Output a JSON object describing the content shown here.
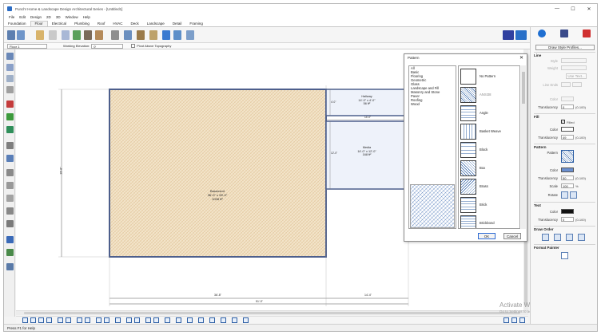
{
  "window": {
    "title": "Punch! Home & Landscape Design Architectural Series - [Untitled1]",
    "controls": [
      "—",
      "☐",
      "✕"
    ]
  },
  "menu": [
    "File",
    "Edit",
    "Design",
    "2D",
    "3D",
    "Window",
    "Help"
  ],
  "tabs": [
    "Foundation",
    "Floor",
    "Electrical",
    "Plumbing",
    "Roof",
    "HVAC",
    "Deck",
    "Landscape",
    "Detail",
    "Framing"
  ],
  "active_tab": "Floor",
  "options_bar": {
    "floor": "Floor 1",
    "working_elevation_label": "Working Elevation:",
    "working_elevation_value": "0'",
    "pivot_label": "Pivot Above Topography"
  },
  "plan": {
    "rooms": [
      {
        "name": "Basement",
        "dims": "36'-0\" x 28'-0\"",
        "area": "1008 ft²"
      },
      {
        "name": "Hallway",
        "dims": "14'-0\" x 4'-0\"",
        "area": "56 ft²"
      },
      {
        "name": "Media",
        "dims": "14'-0\" x 12'-0\"",
        "area": "168 ft²"
      }
    ],
    "dims": {
      "left": "28'-8\"",
      "bottom_main": "36'-8\"",
      "bottom_right": "14'-4\"",
      "bottom_total": "51'-0\"",
      "media_top": "14'-0\"",
      "media_side": "12'-0\"",
      "hall_side": "4'-0\""
    }
  },
  "dialog": {
    "title": "Pattern",
    "close": "✕",
    "categories": [
      "All",
      "Basic",
      "Flooring",
      "Geometric",
      "Glass",
      "Landscape and Fill",
      "Masonry and Stone",
      "Paver",
      "Roofing",
      "Wood"
    ],
    "patterns": [
      "No Pattern",
      "ANSI38",
      "Angle",
      "Basket Weave",
      "Block",
      "Box",
      "Brass",
      "Brick",
      "Brickbond"
    ],
    "selected_pattern": "ANSI38",
    "ok": "OK",
    "cancel": "Cancel"
  },
  "panel": {
    "draw_style_button": "Draw Style Profiles...",
    "line": {
      "header": "Line",
      "style_label": "Style",
      "weight_label": "Weight",
      "use_text_button": "Use Text...",
      "line_ends_label": "Line Ends",
      "color_label": "Color",
      "translucency_label": "Translucency",
      "translucency_value": "0",
      "translucency_unit": "(0-100)"
    },
    "fill": {
      "header": "Fill",
      "filled_label": "Filled",
      "color_label": "Color",
      "translucency_label": "Translucency",
      "translucency_value": "49",
      "translucency_unit": "(0-100)"
    },
    "pattern": {
      "header": "Pattern",
      "pattern_label": "Pattern",
      "color_label": "Color",
      "translucency_label": "Translucency",
      "translucency_value": "50",
      "translucency_unit": "(0-100)",
      "scale_label": "Scale",
      "scale_value": "100",
      "scale_unit": "%",
      "rotate_label": "Rotate"
    },
    "text": {
      "header": "Text",
      "color_label": "Color",
      "translucency_label": "Translucency",
      "translucency_value": "0",
      "translucency_unit": "(0-100)"
    },
    "draw_order_header": "Draw Order",
    "format_painter_header": "Format Painter"
  },
  "status": "Press F1 for Help",
  "watermark": {
    "line1": "Activate Windows",
    "line2": "Go to Settings to activate Windows."
  },
  "colors": {
    "basement_fill": "#f2e3c8",
    "accent": "#2d5fa5",
    "wall": "#5a6e9a"
  }
}
